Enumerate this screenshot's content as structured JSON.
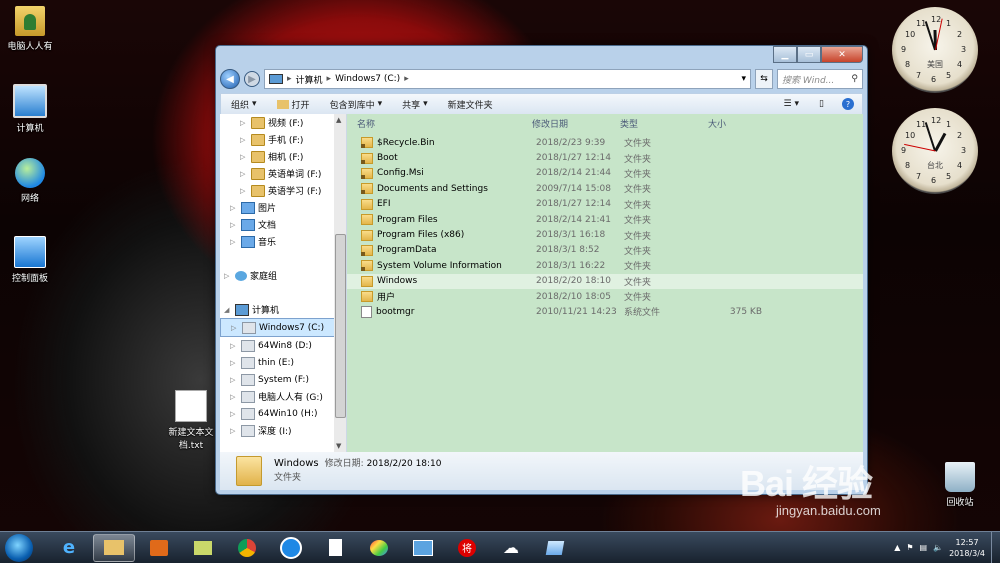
{
  "desktop": {
    "icons": [
      "电脑人人有",
      "计算机",
      "网络",
      "控制面板",
      "新建文本文档.txt",
      "回收站"
    ]
  },
  "window": {
    "breadcrumb": [
      "计算机",
      "Windows7 (C:)"
    ],
    "search_placeholder": "搜索 Wind...",
    "toolbar": [
      "组织",
      "打开",
      "包含到库中",
      "共享",
      "新建文件夹"
    ],
    "nav_tree": [
      {
        "label": "视频 (F:)",
        "icon": "f-lock",
        "indent": 20,
        "tri": "▷"
      },
      {
        "label": "手机 (F:)",
        "icon": "f-lock",
        "indent": 20,
        "tri": "▷"
      },
      {
        "label": "相机 (F:)",
        "icon": "f-lock",
        "indent": 20,
        "tri": "▷"
      },
      {
        "label": "英语单词 (F:)",
        "icon": "f-lock",
        "indent": 20,
        "tri": "▷"
      },
      {
        "label": "英语学习 (F:)",
        "icon": "f-lock",
        "indent": 20,
        "tri": "▷"
      },
      {
        "label": "图片",
        "icon": "f-lib",
        "indent": 10,
        "tri": "▷"
      },
      {
        "label": "文档",
        "icon": "f-lib",
        "indent": 10,
        "tri": "▷"
      },
      {
        "label": "音乐",
        "icon": "f-lib",
        "indent": 10,
        "tri": "▷"
      },
      {
        "label": "",
        "icon": "",
        "indent": 0,
        "tri": ""
      },
      {
        "label": "家庭组",
        "icon": "f-home",
        "indent": 4,
        "tri": "▷"
      },
      {
        "label": "",
        "icon": "",
        "indent": 0,
        "tri": ""
      },
      {
        "label": "计算机",
        "icon": "f-pc",
        "indent": 4,
        "tri": "◢"
      },
      {
        "label": "Windows7 (C:)",
        "icon": "f-drive",
        "indent": 10,
        "tri": "▷",
        "selected": true
      },
      {
        "label": "64Win8  (D:)",
        "icon": "f-drive",
        "indent": 10,
        "tri": "▷"
      },
      {
        "label": "thin (E:)",
        "icon": "f-drive",
        "indent": 10,
        "tri": "▷"
      },
      {
        "label": "System (F:)",
        "icon": "f-drive",
        "indent": 10,
        "tri": "▷"
      },
      {
        "label": "电脑人人有 (G:)",
        "icon": "f-drive",
        "indent": 10,
        "tri": "▷"
      },
      {
        "label": "64Win10 (H:)",
        "icon": "f-drive",
        "indent": 10,
        "tri": "▷"
      },
      {
        "label": "深度 (I:)",
        "icon": "f-drive",
        "indent": 10,
        "tri": "▷"
      }
    ],
    "columns": [
      "名称",
      "修改日期",
      "类型",
      "大小"
    ],
    "files": [
      {
        "name": "$Recycle.Bin",
        "date": "2018/2/23 9:39",
        "type": "文件夹",
        "size": "",
        "icon": "lock"
      },
      {
        "name": "Boot",
        "date": "2018/1/27 12:14",
        "type": "文件夹",
        "size": "",
        "icon": "lock"
      },
      {
        "name": "Config.Msi",
        "date": "2018/2/14 21:44",
        "type": "文件夹",
        "size": "",
        "icon": "lock"
      },
      {
        "name": "Documents and Settings",
        "date": "2009/7/14 15:08",
        "type": "文件夹",
        "size": "",
        "icon": "lock"
      },
      {
        "name": "EFI",
        "date": "2018/1/27 12:14",
        "type": "文件夹",
        "size": "",
        "icon": "folder"
      },
      {
        "name": "Program Files",
        "date": "2018/2/14 21:41",
        "type": "文件夹",
        "size": "",
        "icon": "folder"
      },
      {
        "name": "Program Files (x86)",
        "date": "2018/3/1 16:18",
        "type": "文件夹",
        "size": "",
        "icon": "folder"
      },
      {
        "name": "ProgramData",
        "date": "2018/3/1 8:52",
        "type": "文件夹",
        "size": "",
        "icon": "lock"
      },
      {
        "name": "System Volume Information",
        "date": "2018/3/1 16:22",
        "type": "文件夹",
        "size": "",
        "icon": "lock"
      },
      {
        "name": "Windows",
        "date": "2018/2/20 18:10",
        "type": "文件夹",
        "size": "",
        "icon": "folder",
        "highlight": true
      },
      {
        "name": "用户",
        "date": "2018/2/10 18:05",
        "type": "文件夹",
        "size": "",
        "icon": "folder"
      },
      {
        "name": "bootmgr",
        "date": "2010/11/21 14:23",
        "type": "系统文件",
        "size": "375 KB",
        "icon": "file"
      }
    ],
    "details": {
      "name": "Windows",
      "date_label": "修改日期:",
      "date": "2018/2/20 18:10",
      "type": "文件夹"
    }
  },
  "clocks": [
    {
      "city": "美国",
      "hour": 11,
      "minute": 57,
      "second": 2
    },
    {
      "city": "台北",
      "hour": 12,
      "minute": 57,
      "second": 47
    }
  ],
  "taskbar": {
    "time": "12:57",
    "date": "2018/3/4"
  },
  "watermark": {
    "main": "Bai  经验",
    "sub": "jingyan.baidu.com"
  }
}
